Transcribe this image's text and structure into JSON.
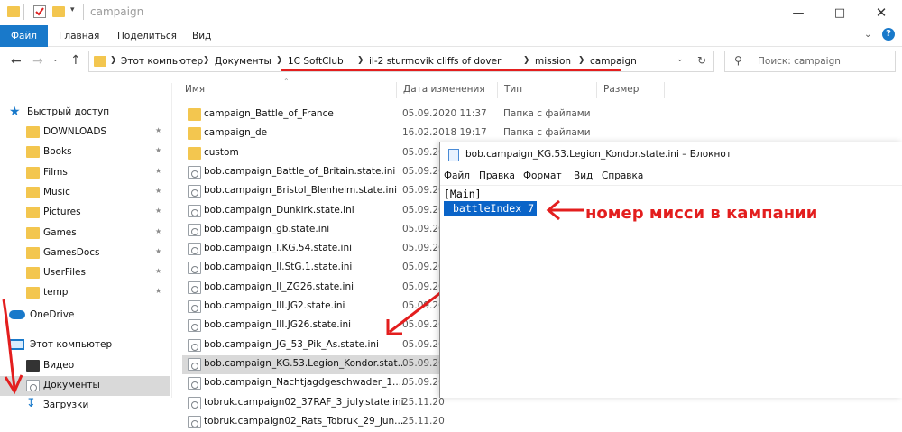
{
  "window": {
    "title": "campaign"
  },
  "ribbon": {
    "tabs": [
      "Файл",
      "Главная",
      "Поделиться",
      "Вид"
    ]
  },
  "address": {
    "crumbs": [
      "Этот компьютер",
      "Документы",
      "1C SoftClub",
      "il-2 sturmovik cliffs of dover",
      "mission",
      "campaign"
    ]
  },
  "search": {
    "placeholder": "Поиск: campaign"
  },
  "nav": {
    "quick_access": "Быстрый доступ",
    "pinned": [
      "DOWNLOADS",
      "Books",
      "Films",
      "Music",
      "Pictures",
      "Games",
      "GamesDocs",
      "UserFiles",
      "temp"
    ],
    "onedrive": "OneDrive",
    "this_pc": "Этот компьютер",
    "pc_items": [
      "Видео",
      "Документы",
      "Загрузки"
    ]
  },
  "columns": {
    "name": "Имя",
    "date": "Дата изменения",
    "type": "Тип",
    "size": "Размер"
  },
  "files": [
    {
      "name": "campaign_Battle_of_France",
      "date": "05.09.2020 11:37",
      "type": "Папка с файлами",
      "kind": "folder"
    },
    {
      "name": "campaign_de",
      "date": "16.02.2018 19:17",
      "type": "Папка с файлами",
      "kind": "folder"
    },
    {
      "name": "custom",
      "date": "05.09.20",
      "type": "",
      "kind": "folder"
    },
    {
      "name": "bob.campaign_Battle_of_Britain.state.ini",
      "date": "05.09.20",
      "type": "",
      "kind": "file"
    },
    {
      "name": "bob.campaign_Bristol_Blenheim.state.ini",
      "date": "05.09.20",
      "type": "",
      "kind": "file"
    },
    {
      "name": "bob.campaign_Dunkirk.state.ini",
      "date": "05.09.20",
      "type": "",
      "kind": "file"
    },
    {
      "name": "bob.campaign_gb.state.ini",
      "date": "05.09.20",
      "type": "",
      "kind": "file"
    },
    {
      "name": "bob.campaign_I.KG.54.state.ini",
      "date": "05.09.20",
      "type": "",
      "kind": "file"
    },
    {
      "name": "bob.campaign_II.StG.1.state.ini",
      "date": "05.09.20",
      "type": "",
      "kind": "file"
    },
    {
      "name": "bob.campaign_II_ZG26.state.ini",
      "date": "05.09.20",
      "type": "",
      "kind": "file"
    },
    {
      "name": "bob.campaign_III.JG2.state.ini",
      "date": "05.09.20",
      "type": "",
      "kind": "file"
    },
    {
      "name": "bob.campaign_III.JG26.state.ini",
      "date": "05.09.20",
      "type": "",
      "kind": "file"
    },
    {
      "name": "bob.campaign_JG_53_Pik_As.state.ini",
      "date": "05.09.20",
      "type": "",
      "kind": "file"
    },
    {
      "name": "bob.campaign_KG.53.Legion_Kondor.stat...",
      "date": "05.09.20",
      "type": "",
      "kind": "file"
    },
    {
      "name": "bob.campaign_Nachtjagdgeschwader_1....",
      "date": "05.09.20",
      "type": "",
      "kind": "file"
    },
    {
      "name": "tobruk.campaign02_37RAF_3_july.state.ini",
      "date": "25.11.20",
      "type": "",
      "kind": "file"
    },
    {
      "name": "tobruk.campaign02_Rats_Tobruk_29_jun...",
      "date": "25.11.20",
      "type": "",
      "kind": "file"
    }
  ],
  "notepad": {
    "title": "bob.campaign_KG.53.Legion_Kondor.state.ini – Блокнот",
    "menu": [
      "Файл",
      "Правка",
      "Формат",
      "Вид",
      "Справка"
    ],
    "line1": "[Main]",
    "line2": "battleIndex 7"
  },
  "annotation": {
    "text": "номер мисси в кампании",
    "color": "#e31e1e"
  },
  "colors": {
    "accent": "#1979ca",
    "selection": "#0a64c8",
    "folder": "#f3c64f"
  }
}
